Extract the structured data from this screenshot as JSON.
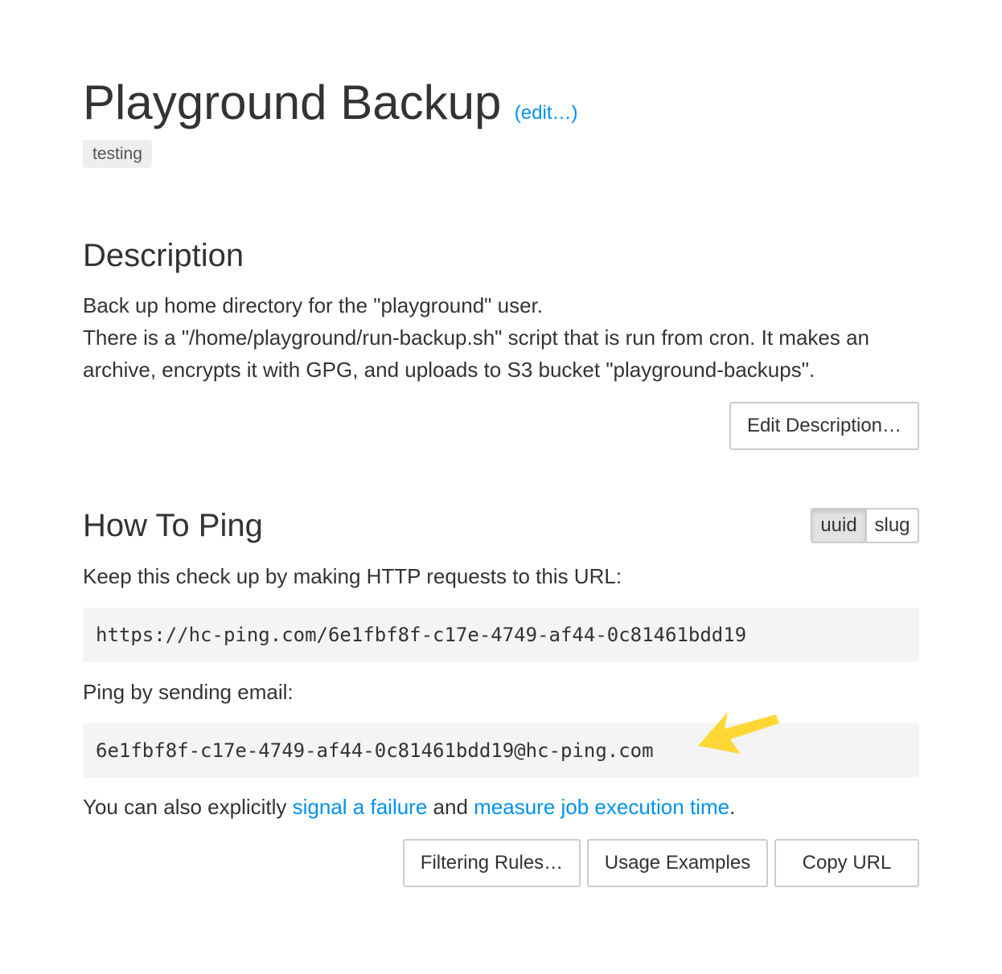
{
  "header": {
    "title": "Playground Backup",
    "edit_link": "(edit…)",
    "tags": [
      "testing"
    ]
  },
  "description": {
    "heading": "Description",
    "lines": [
      "Back up home directory for the \"playground\" user.",
      "There is a \"/home/playground/run-backup.sh\" script that is run from cron. It makes an archive, encrypts it with GPG, and uploads to S3 bucket \"playground-backups\"."
    ],
    "edit_button": "Edit Description…"
  },
  "how_to_ping": {
    "heading": "How To Ping",
    "toggle": {
      "options": [
        "uuid",
        "slug"
      ],
      "selected": "uuid"
    },
    "url_label": "Keep this check up by making HTTP requests to this URL:",
    "url": "https://hc-ping.com/6e1fbf8f-c17e-4749-af44-0c81461bdd19",
    "email_label": "Ping by sending email:",
    "email": "6e1fbf8f-c17e-4749-af44-0c81461bdd19@hc-ping.com",
    "annotation_arrow": "yellow-arrow-icon",
    "also_prefix": "You can also explicitly ",
    "signal_failure_link": "signal a failure",
    "also_and": " and ",
    "measure_time_link": "measure job execution time",
    "also_suffix": ".",
    "buttons": {
      "filtering_rules": "Filtering Rules…",
      "usage_examples": "Usage Examples",
      "copy_url": "Copy URL"
    }
  },
  "colors": {
    "link": "#0091ea",
    "text": "#333333",
    "code_bg": "#f4f4f4",
    "tag_bg": "#eeeeee",
    "arrow": "#fdd835"
  }
}
